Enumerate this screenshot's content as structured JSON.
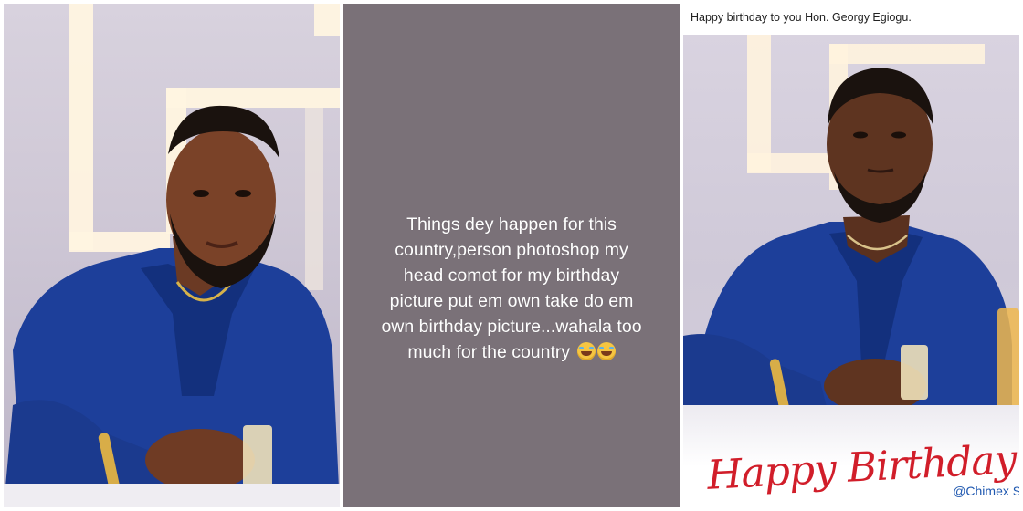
{
  "middle": {
    "lines": [
      "Things dey happen for this",
      "country,person photoshop my",
      "head comot for my birthday",
      "picture put em own take do em",
      "own birthday picture...wahala too",
      "much for the country"
    ],
    "emoji_icons": [
      "laughing-tears-emoji-icon",
      "laughing-tears-emoji-icon"
    ]
  },
  "right": {
    "caption": "Happy birthday to you Hon. Georgy Egiogu.",
    "poster_text": "Happy Birthday",
    "credit": "@Chimex St"
  },
  "colors": {
    "story_background": "#7a7178",
    "suit_blue": "#1d3f9a",
    "happy_birthday_red": "#d11e2a",
    "credit_blue": "#1f58b0"
  }
}
